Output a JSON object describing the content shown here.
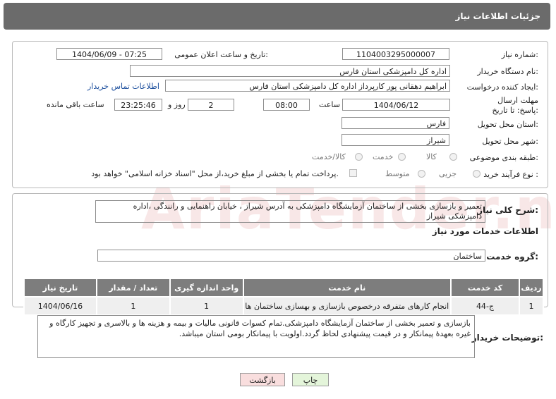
{
  "header": {
    "title": "جزئیات اطلاعات نیاز"
  },
  "watermark": "AriaTender.neT",
  "form": {
    "need_number_label": "شماره نیاز:",
    "need_number": "1104003295000007",
    "announce_label": "تاریخ و ساعت اعلان عمومی:",
    "announce_value": "1404/06/09 - 07:25",
    "buyer_label": "نام دستگاه خریدار:",
    "buyer_value": "اداره کل دامپزشکی استان فارس",
    "creator_label": "ایجاد کننده درخواست:",
    "creator_value": "ابراهیم دهقانی پور کارپرداز اداره کل دامپزشکی استان فارس",
    "contact_link": "اطلاعات تماس خریدار",
    "deadline_label": "مهلت ارسال پاسخ: تا تاریخ:",
    "deadline_date": "1404/06/12",
    "hour_label": "ساعت",
    "deadline_time": "08:00",
    "days_value": "2",
    "days_label": "روز و",
    "remaining_time": "23:25:46",
    "remaining_label": "ساعت باقی مانده",
    "province_label": "استان محل تحویل:",
    "province_value": "فارس",
    "city_label": "شهر محل تحویل:",
    "city_value": "شیراز",
    "category_label": "طبقه بندی موضوعی:",
    "category_options": [
      "کالا",
      "خدمت",
      "کالا/خدمت"
    ],
    "process_label": "نوع فرآیند خرید :",
    "process_options": [
      "جزیی",
      "متوسط"
    ],
    "payment_note": "پرداخت تمام یا بخشی از مبلغ خرید،از محل \"اسناد خزانه اسلامی\" خواهد بود."
  },
  "description": {
    "label": "شرح کلی نیاز:",
    "text": "تعمیر و بازسازی بخشی از ساختمان آزمایشگاه دامپزشکی به آدرس شیراز ، خیابان راهنمایی و رانندگی ،اداره دامپزشکی شیراز"
  },
  "services": {
    "section_title": "اطلاعات خدمات مورد نیاز",
    "group_label": "گروه خدمت:",
    "group_value": "ساختمان",
    "columns": [
      "ردیف",
      "کد خدمت",
      "نام خدمت",
      "واحد اندازه گیری",
      "تعداد / مقدار",
      "تاریخ نیاز"
    ],
    "rows": [
      {
        "row": "1",
        "code": "ج-44",
        "name": "انجام کارهای متفرقه درخصوص بازسازی و بهسازی ساختمان ها",
        "unit": "1",
        "qty": "1",
        "date": "1404/06/16"
      }
    ]
  },
  "buyer_notes": {
    "label": "توضیحات خریدار:",
    "text": "بازسازی و تعمیر بخشی از ساختمان آزمایشگاه دامپزشکی.تمام کسوات قانونی مالیات و بیمه و هزینه ها و بالاسری و تجهیز کارگاه و غیره بعهدهٔ پیمانکار و در قیمت پیشنهادی لحاظ گردد.اولویت با پیمانکار بومی استان میباشد."
  },
  "buttons": {
    "print": "چاپ",
    "back": "بازگشت"
  },
  "colors": {
    "header_bg": "#6b6b6b",
    "table_header_bg": "#7d7d7d",
    "print_bg": "#e4f5da",
    "back_bg": "#f9dede",
    "link": "#1a4d9c"
  }
}
